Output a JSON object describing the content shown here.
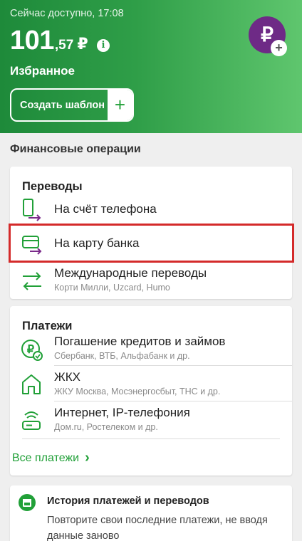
{
  "header": {
    "status": "Сейчас доступно, 17:08",
    "balance_main": "101",
    "balance_frac": ",57",
    "currency": "₽",
    "favorites": "Избранное",
    "create_template": "Создать шаблон",
    "plus": "+",
    "avatar_symbol": "₽"
  },
  "fin_ops": {
    "title": "Финансовые операции"
  },
  "transfers": {
    "title": "Переводы",
    "items": [
      {
        "label": "На счёт телефона",
        "sub": ""
      },
      {
        "label": "На карту банка",
        "sub": ""
      },
      {
        "label": "Международные переводы",
        "sub": "Корти Милли, Uzcard, Humo"
      }
    ]
  },
  "payments": {
    "title": "Платежи",
    "items": [
      {
        "label": "Погашение кредитов и займов",
        "sub": "Сбербанк, ВТБ, Альфабанк и др."
      },
      {
        "label": "ЖКХ",
        "sub": "ЖКУ Москва, Мосэнергосбыт, ТНС и др."
      },
      {
        "label": "Интернет, IP-телефония",
        "sub": "Дом.ru, Ростелеком и др."
      }
    ],
    "all_label": "Все платежи",
    "chevron": "›"
  },
  "history": {
    "title": "История платежей и переводов",
    "text": "Повторите свои последние платежи, не вводя данные заново"
  },
  "colors": {
    "accent_green": "#21a038",
    "highlight_red": "#d42a2a",
    "avatar_purple": "#6e2a86",
    "arrow_purple": "#7a2a8a"
  }
}
